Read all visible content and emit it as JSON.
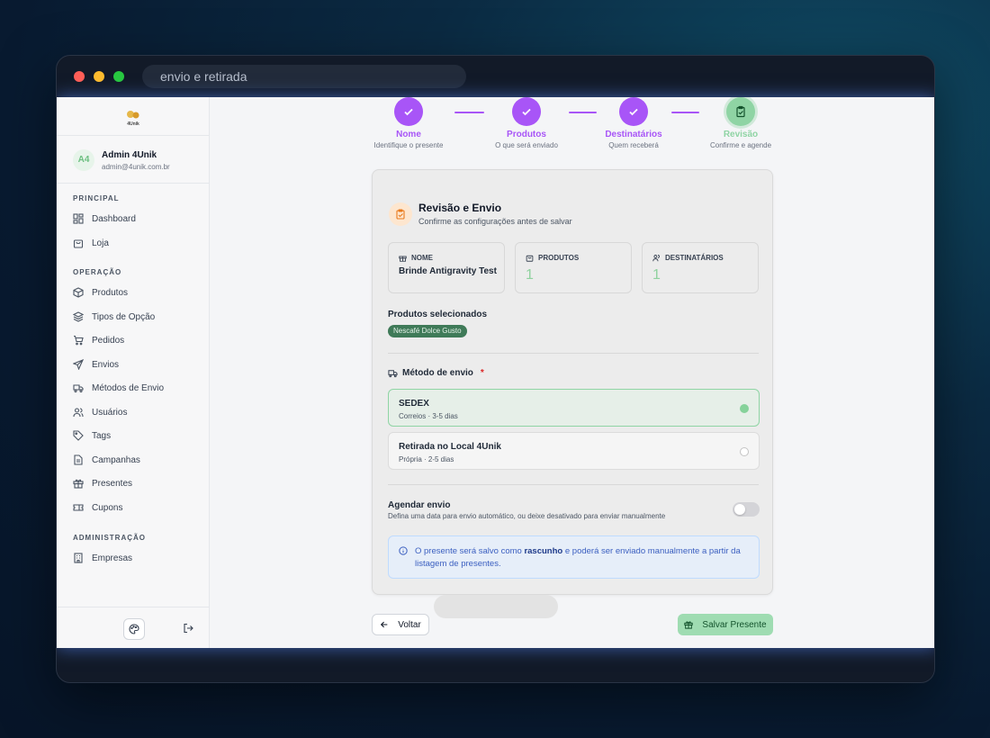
{
  "browser": {
    "url_text": "envio e retirada"
  },
  "sidebar": {
    "logo_text": "4Unik",
    "user": {
      "initials": "A4",
      "name": "Admin 4Unik",
      "email": "admin@4unik.com.br"
    },
    "sections": [
      {
        "title": "PRINCIPAL",
        "items": [
          {
            "label": "Dashboard",
            "icon": "dashboard-icon"
          },
          {
            "label": "Loja",
            "icon": "shopping-bag-icon"
          }
        ]
      },
      {
        "title": "OPERAÇÃO",
        "items": [
          {
            "label": "Produtos",
            "icon": "box-icon"
          },
          {
            "label": "Tipos de Opção",
            "icon": "layers-icon"
          },
          {
            "label": "Pedidos",
            "icon": "cart-icon"
          },
          {
            "label": "Envios",
            "icon": "send-icon"
          },
          {
            "label": "Métodos de Envio",
            "icon": "truck-icon"
          },
          {
            "label": "Usuários",
            "icon": "users-icon"
          },
          {
            "label": "Tags",
            "icon": "tag-icon"
          },
          {
            "label": "Campanhas",
            "icon": "file-icon"
          },
          {
            "label": "Presentes",
            "icon": "gift-icon"
          },
          {
            "label": "Cupons",
            "icon": "ticket-icon"
          }
        ]
      },
      {
        "title": "ADMINISTRAÇÃO",
        "items": [
          {
            "label": "Empresas",
            "icon": "building-icon"
          }
        ]
      }
    ]
  },
  "stepper": [
    {
      "title": "Nome",
      "subtitle": "Identifique o presente",
      "state": "done"
    },
    {
      "title": "Produtos",
      "subtitle": "O que será enviado",
      "state": "done"
    },
    {
      "title": "Destinatários",
      "subtitle": "Quem receberá",
      "state": "done"
    },
    {
      "title": "Revisão",
      "subtitle": "Confirme e agende",
      "state": "current"
    }
  ],
  "review": {
    "title": "Revisão e Envio",
    "subtitle": "Confirme as configurações antes de salvar",
    "summary": {
      "name_label": "NOME",
      "name_value": "Brinde Antigravity Test",
      "products_label": "PRODUTOS",
      "products_value": "1",
      "recipients_label": "DESTINATÁRIOS",
      "recipients_value": "1"
    },
    "selected_label": "Produtos selecionados",
    "selected_tags": [
      "Nescafé Dolce Gusto"
    ],
    "shipping_label": "Método de envio",
    "required_mark": "*",
    "shipping_options": [
      {
        "name": "SEDEX",
        "detail": "Correios · 3-5 dias",
        "selected": true
      },
      {
        "name": "Retirada no Local 4Unik",
        "detail": "Própria · 2-5 dias",
        "selected": false
      }
    ],
    "schedule_title": "Agendar envio",
    "schedule_subtitle": "Defina uma data para envio automático, ou deixe desativado para enviar manualmente",
    "schedule_enabled": false,
    "info_prefix": "O presente será salvo como ",
    "info_bold": "rascunho",
    "info_suffix": " e poderá ser enviado manualmente a partir da listagem de presentes."
  },
  "footer": {
    "back_label": "Voltar",
    "save_label": "Salvar Presente"
  },
  "colors": {
    "accent": "#a855f7",
    "success": "#86d29a",
    "info": "#3b5fc0"
  }
}
